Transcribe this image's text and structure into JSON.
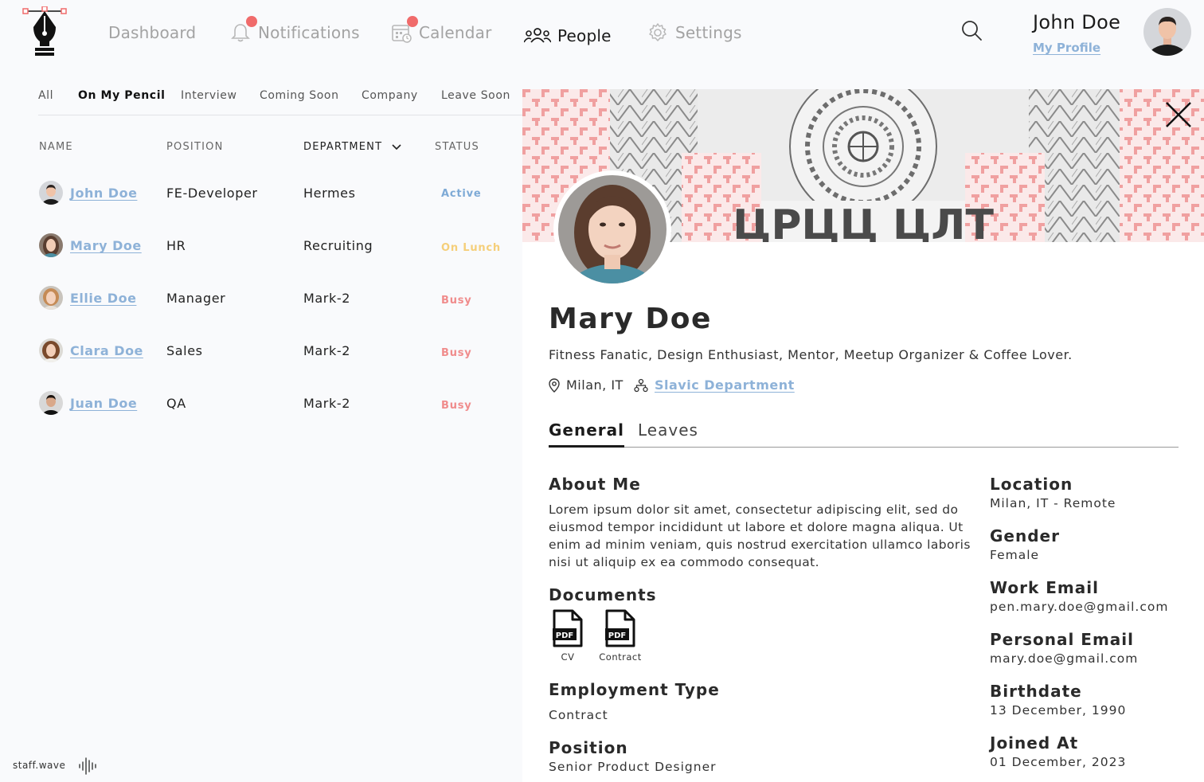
{
  "nav": {
    "items": [
      {
        "label": "Dashboard",
        "icon": "dashboard"
      },
      {
        "label": "Notifications",
        "icon": "bell-icon"
      },
      {
        "label": "Calendar",
        "icon": "calendar-icon"
      },
      {
        "label": "People",
        "icon": "people-icon"
      },
      {
        "label": "Settings",
        "icon": "gear-icon"
      }
    ],
    "active": "People"
  },
  "user": {
    "name": "John Doe",
    "profile_link": "My Profile"
  },
  "filters": {
    "tabs": [
      "All",
      "On My Pencil",
      "Interview",
      "Coming Soon",
      "Company",
      "Leave Soon"
    ],
    "active": "On My Pencil"
  },
  "table": {
    "headers": {
      "name": "NAME",
      "position": "POSITION",
      "department": "DEPARTMENT",
      "status": "STATUS"
    },
    "rows": [
      {
        "name": "John Doe",
        "position": "FE-Developer",
        "department": "Hermes",
        "status": "Active"
      },
      {
        "name": "Mary Doe",
        "position": "HR",
        "department": "Recruiting",
        "status": "On Lunch"
      },
      {
        "name": "Ellie Doe",
        "position": "Manager",
        "department": "Mark-2",
        "status": "Busy"
      },
      {
        "name": "Clara Doe",
        "position": "Sales",
        "department": "Mark-2",
        "status": "Busy"
      },
      {
        "name": "Juan Doe",
        "position": "QA",
        "department": "Mark-2",
        "status": "Busy"
      }
    ]
  },
  "status_colors": {
    "Active": "#7eaad6",
    "On Lunch": "#f5cf7a",
    "Busy": "#f08c8c"
  },
  "brand": {
    "name": "staff.wave"
  },
  "profile": {
    "name": "Mary Doe",
    "bio": "Fitness Fanatic, Design Enthusiast, Mentor, Meetup Organizer & Coffee Lover.",
    "location": "Milan, IT",
    "department": "Slavic Department",
    "tabs": [
      "General",
      "Leaves"
    ],
    "active_tab": "General",
    "about_title": "About Me",
    "about": "Lorem ipsum dolor sit amet, consectetur adipiscing elit, sed do eiusmod tempor incididunt ut labore et dolore magna aliqua. Ut enim ad minim veniam, quis nostrud exercitation ullamco laboris nisi ut aliquip ex ea commodo consequat.",
    "documents_title": "Documents",
    "documents": [
      {
        "label": "CV",
        "badge": "PDF"
      },
      {
        "label": "Contract",
        "badge": "PDF"
      }
    ],
    "employment_type_title": "Employment Type",
    "employment_type": "Contract",
    "position_title": "Position",
    "position": "Senior Product Designer",
    "details": [
      {
        "label": "Location",
        "value": "Milan, IT - Remote"
      },
      {
        "label": "Gender",
        "value": "Female"
      },
      {
        "label": "Work Email",
        "value": "pen.mary.doe@gmail.com"
      },
      {
        "label": "Personal Email",
        "value": "mary.doe@gmail.com"
      },
      {
        "label": "Birthdate",
        "value": "13 December, 1990"
      },
      {
        "label": "Joined At",
        "value": "01 December, 2023"
      }
    ]
  },
  "cover_text": "ЦРЦЦ ЦЛТ",
  "colors": {
    "accent": "#8eb2d8",
    "notification_dot": "#f06b6b",
    "cover_pattern": "#f0a0a0"
  }
}
